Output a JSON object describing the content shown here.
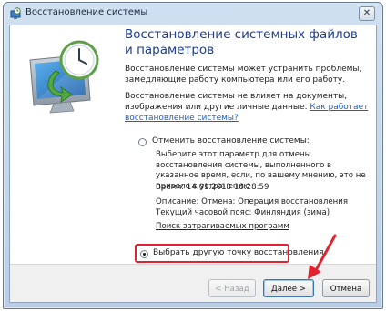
{
  "window": {
    "title": "Восстановление системы",
    "close_label": "✕"
  },
  "main": {
    "heading": "Восстановление системных файлов и параметров",
    "para1": "Восстановление системы может устранить проблемы, замедляющие работу компьютера или его работу.",
    "para2_text": "Восстановление системы не влияет на документы, изображения или другие личные данные.",
    "para2_link": "Как работает восстановление системы?",
    "undo_option": {
      "label": "Отменить восстановление системы:",
      "description": "Выберите этот параметр для отмены восстановления системы, выполненного в указанное время, если, по вашему мнению, это не привело к устранению",
      "time": "Время: 14.01.2013 18:28:59",
      "description_line": "Описание: Отмена: Операция восстановления",
      "timezone": "Текущий часовой пояс: Финляндия (зима)",
      "affected_link": "Поиск затрагиваемых программ",
      "selected": false
    },
    "other_option": {
      "label": "Выбрать другую точку восстановления",
      "selected": true
    }
  },
  "buttons": {
    "back": "< Назад",
    "next": "Далее >",
    "cancel": "Отмена"
  },
  "colors": {
    "heading": "#1e3d8f",
    "link": "#1a5fc8",
    "highlight": "#e0232f"
  }
}
